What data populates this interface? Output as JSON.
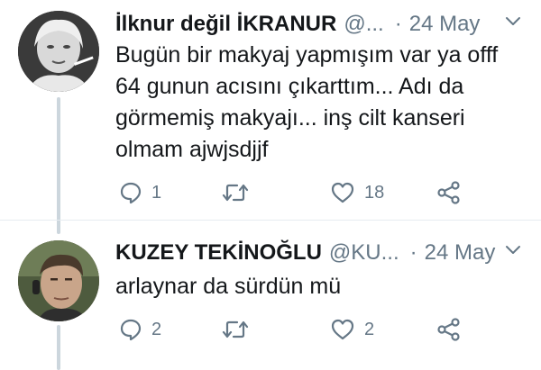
{
  "tweets": [
    {
      "author_name": "İlknur değil İKRANUR",
      "handle": "@...",
      "separator": "·",
      "date": "24 May",
      "text_lines": [
        "Bugün bir makyaj yapmışım var ya offf",
        "64 gunun acısını çıkarttım... Adı da",
        "görmemiş makyajı... inş cilt kanseri",
        "olmam ajwjsdjjf"
      ],
      "reply_count": "1",
      "retweet_count": "",
      "like_count": "18"
    },
    {
      "author_name": "KUZEY TEKİNOĞLU",
      "handle": "@KU...",
      "separator": "·",
      "date": "24 May",
      "text_lines": [
        "arlaynar da sürdün mü"
      ],
      "reply_count": "2",
      "retweet_count": "",
      "like_count": "2"
    }
  ],
  "icons": {
    "reply": "reply-icon",
    "retweet": "retweet-icon",
    "like": "heart-icon",
    "share": "share-icon",
    "menu": "chevron-down-icon"
  },
  "colors": {
    "text_primary": "#14171a",
    "text_secondary": "#657786",
    "thread_line": "#ccd6dd"
  }
}
